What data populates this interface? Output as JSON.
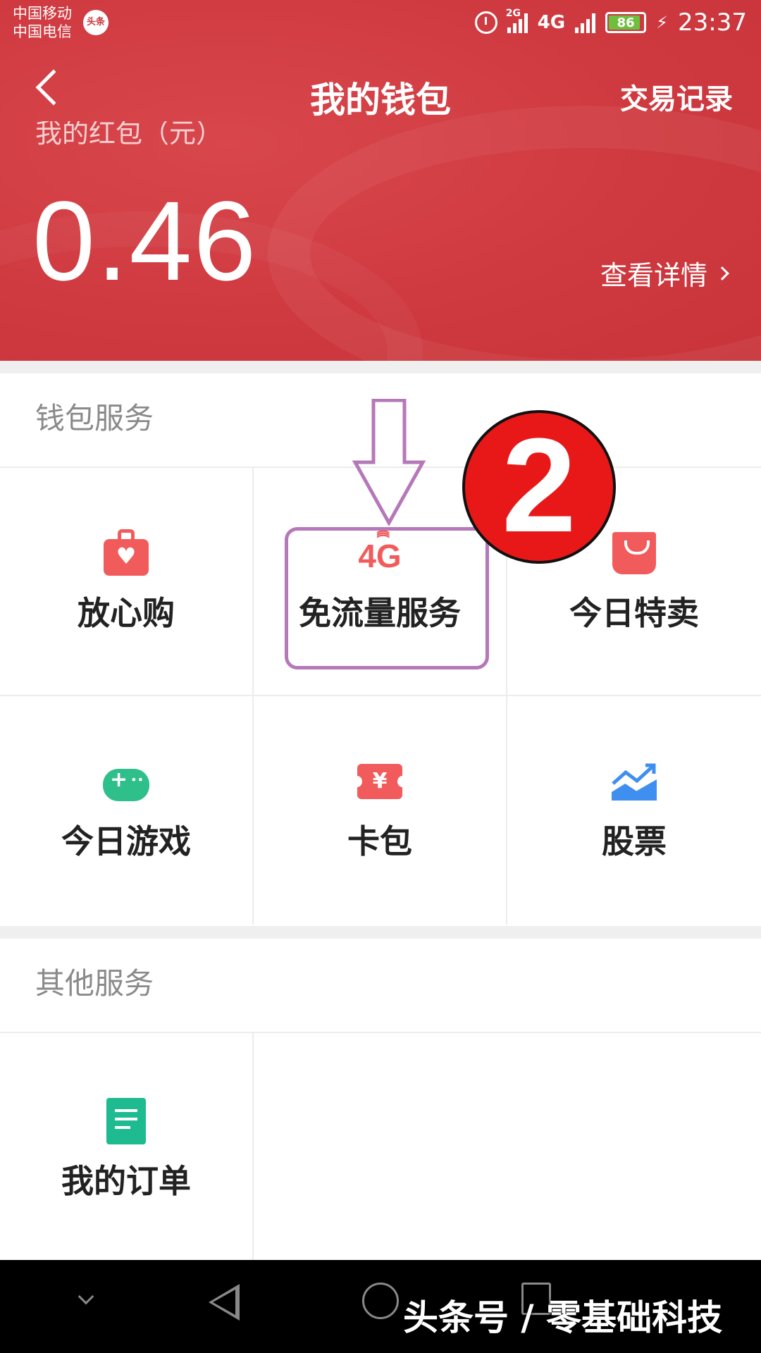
{
  "status_bar": {
    "carrier_1": "中国移动",
    "carrier_2": "中国电信",
    "carrier_logo": "头条",
    "net_2g": "2G",
    "net_4g": "4G",
    "net_4g2g": "4G 2G",
    "battery": "86",
    "time": "23:37",
    "icons": [
      "alarm-icon",
      "signal-icon",
      "battery-icon",
      "charging-icon"
    ]
  },
  "nav": {
    "title": "我的钱包",
    "right_action": "交易记录",
    "back_icon": "back-arrow-icon"
  },
  "balance": {
    "label": "我的红包（元）",
    "value": "0.46",
    "detail_link": "查看详情"
  },
  "wallet_services": {
    "title": "钱包服务",
    "items": [
      {
        "label": "放心购",
        "icon": "heart-bag-icon"
      },
      {
        "label": "免流量服务",
        "icon": "4g-icon",
        "icon_text": "4G"
      },
      {
        "label": "今日特卖",
        "icon": "shopping-bag-icon"
      },
      {
        "label": "今日游戏",
        "icon": "gamepad-icon"
      },
      {
        "label": "卡包",
        "icon": "ticket-icon",
        "icon_text": "¥"
      },
      {
        "label": "股票",
        "icon": "stock-chart-icon"
      }
    ]
  },
  "other_services": {
    "title": "其他服务",
    "items": [
      {
        "label": "我的订单",
        "icon": "order-document-icon"
      }
    ]
  },
  "annotation": {
    "step_number": "2",
    "highlight_color": "#b578b8",
    "badge_color": "#e81818"
  },
  "watermark": "头条号 / 零基础科技",
  "colors": {
    "header_red": "#cf3a40",
    "accent_red": "#f25b5b",
    "green": "#2fbf8a",
    "blue": "#3f8ff0"
  }
}
